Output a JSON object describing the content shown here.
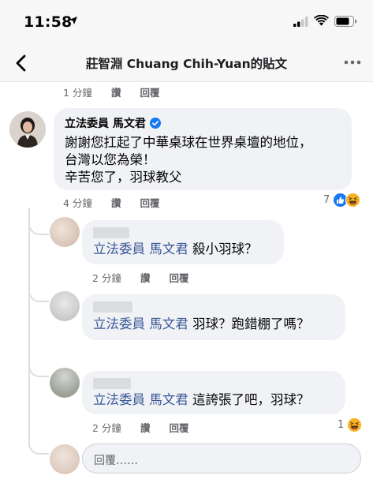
{
  "status_bar": {
    "time": "11:58"
  },
  "nav": {
    "title": "莊智淵  Chuang Chih-Yuan的貼文"
  },
  "prev_meta": {
    "time": "1 分鐘",
    "like": "讚",
    "reply": "回覆"
  },
  "main_comment": {
    "author": "立法委員 馬文君",
    "lines": [
      "謝謝您扛起了中華桌球在世界桌壇的地位，",
      "台灣以您為榮！",
      "辛苦您了，羽球教父"
    ],
    "time": "4 分鐘",
    "like": "讚",
    "reply": "回覆",
    "reaction_count": "7"
  },
  "replies": [
    {
      "mention": "立法委員 馬文君",
      "text": " 殺小羽球？",
      "time": "2 分鐘",
      "like": "讚",
      "reply": "回覆"
    },
    {
      "mention": "立法委員 馬文君",
      "text": " 羽球？跑錯棚了嗎？"
    },
    {
      "mention": "立法委員 馬文君",
      "text": " 這誇張了吧，羽球？",
      "time": "2 分鐘",
      "like": "讚",
      "reply": "回覆",
      "reaction_count": "1"
    }
  ],
  "reply_box": {
    "placeholder": "回覆……"
  },
  "colors": {
    "link": "#385898",
    "bubble": "#f0f2f5",
    "meta": "#65676b",
    "like_blue": "#1877f2",
    "haha_yellow": "#f7b125"
  }
}
